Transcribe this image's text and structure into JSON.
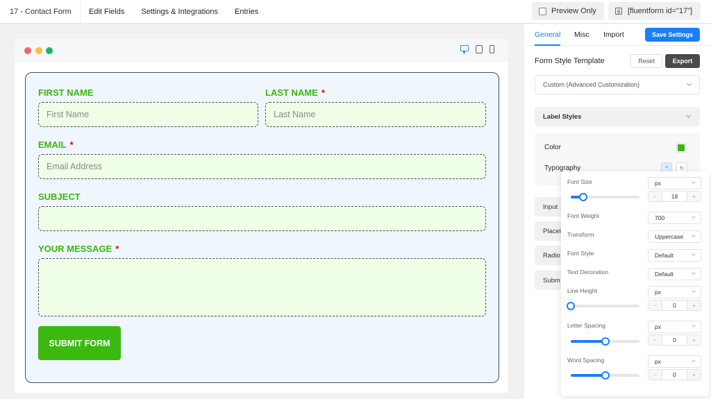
{
  "topbar": {
    "form_title": "17 - Contact Form",
    "nav": [
      "Edit Fields",
      "Settings & Integrations",
      "Entries"
    ],
    "preview_only_label": "Preview Only",
    "preview_only_checked": false,
    "shortcode": "[fluentform id=\"17\"]"
  },
  "preview": {
    "device_icons": [
      "desktop-icon",
      "tablet-icon",
      "mobile-icon"
    ],
    "active_device": "desktop",
    "form": {
      "fields": [
        {
          "label": "FIRST NAME",
          "required": false,
          "placeholder": "First Name",
          "type": "text"
        },
        {
          "label": "LAST NAME",
          "required": true,
          "placeholder": "Last Name",
          "type": "text"
        },
        {
          "label": "EMAIL",
          "required": true,
          "placeholder": "Email Address",
          "type": "email"
        },
        {
          "label": "SUBJECT",
          "required": false,
          "placeholder": "",
          "type": "text"
        },
        {
          "label": "YOUR MESSAGE",
          "required": true,
          "placeholder": "",
          "type": "textarea"
        }
      ],
      "required_marker": "*",
      "submit_label": "SUBMIT FORM"
    },
    "colors": {
      "label": "#3db510",
      "input_bg": "#efffe8",
      "form_bg": "#f0f6fe",
      "submit_bg": "#3bb90f",
      "required": "#ee0000"
    }
  },
  "settings": {
    "tabs": [
      "General",
      "Misc",
      "Import"
    ],
    "active_tab": "General",
    "save_label": "Save Settings",
    "style_template_title": "Form Style Template",
    "reset_label": "Reset",
    "export_label": "Export",
    "template_value": "Custom (Advanced Customization)",
    "label_styles": {
      "title": "Label Styles",
      "color_label": "Color",
      "color_value": "#3db510",
      "typography_label": "Typography"
    },
    "collapsed_sections": [
      "Input",
      "Placel",
      "Radio",
      "Subm"
    ],
    "typography": {
      "font_size_label": "Font Size",
      "font_size_unit": "px",
      "font_size_value": "18",
      "font_size_slider": 0.18,
      "font_weight_label": "Font Weight",
      "font_weight_value": "700",
      "transform_label": "Transform",
      "transform_value": "Uppercase",
      "font_style_label": "Font Style",
      "font_style_value": "Default",
      "text_decoration_label": "Text Decoration",
      "text_decoration_value": "Default",
      "line_height_label": "Line Height",
      "line_height_unit": "px",
      "line_height_value": "0",
      "line_height_slider": 0.0,
      "letter_spacing_label": "Letter Spacing",
      "letter_spacing_unit": "px",
      "letter_spacing_value": "0",
      "letter_spacing_slider": 0.5,
      "word_spacing_label": "Word Spacing",
      "word_spacing_unit": "px",
      "word_spacing_value": "0",
      "word_spacing_slider": 0.5,
      "minus": "−",
      "plus": "+"
    }
  }
}
